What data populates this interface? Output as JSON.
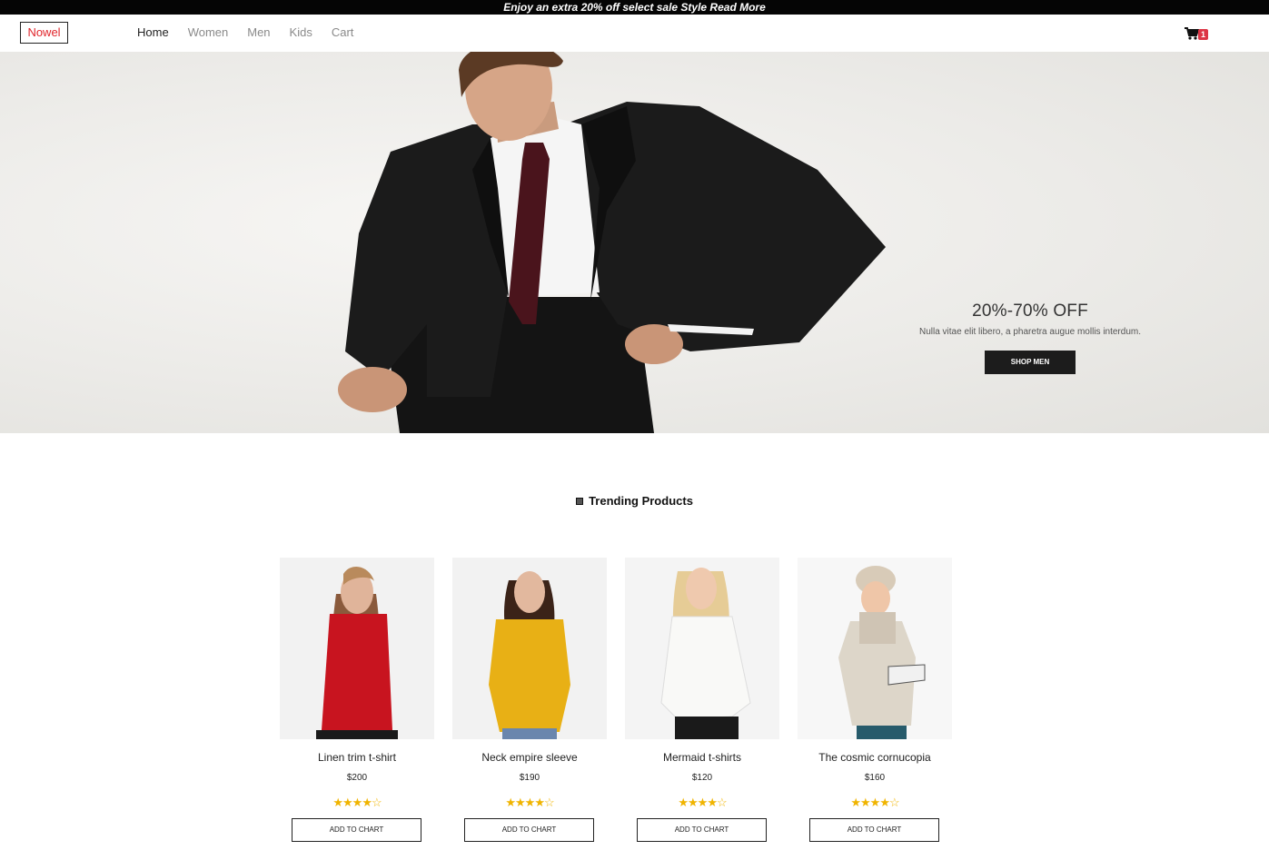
{
  "promo": {
    "text": "Enjoy an extra 20% off select sale Style Read More"
  },
  "nav": {
    "logo": "Nowel",
    "links": [
      "Home",
      "Women",
      "Men",
      "Kids",
      "Cart"
    ],
    "active": "Home",
    "cart_count": "1"
  },
  "hero": {
    "title": "20%-70% OFF",
    "subtitle": "Nulla vitae elit libero, a pharetra augue mollis interdum.",
    "button": "SHOP MEN"
  },
  "trending": {
    "title": "Trending Products",
    "products": [
      {
        "name": "Linen trim t-shirt",
        "price": "$200",
        "rating": 4,
        "max_rating": 5,
        "button": "ADD TO CHART",
        "shirt_color": "#c8141f"
      },
      {
        "name": "Neck empire sleeve",
        "price": "$190",
        "rating": 4,
        "max_rating": 5,
        "button": "ADD TO CHART",
        "shirt_color": "#e8b015"
      },
      {
        "name": "Mermaid t-shirts",
        "price": "$120",
        "rating": 4,
        "max_rating": 5,
        "button": "ADD TO CHART",
        "shirt_color": "#f7f7f5"
      },
      {
        "name": "The cosmic cornucopia",
        "price": "$160",
        "rating": 4,
        "max_rating": 5,
        "button": "ADD TO CHART",
        "shirt_color": "#ddd6c9"
      }
    ]
  },
  "colors": {
    "accent": "#e0252b",
    "badge": "#dc3545",
    "star": "#f0b400",
    "dark": "#1c1c1c"
  }
}
